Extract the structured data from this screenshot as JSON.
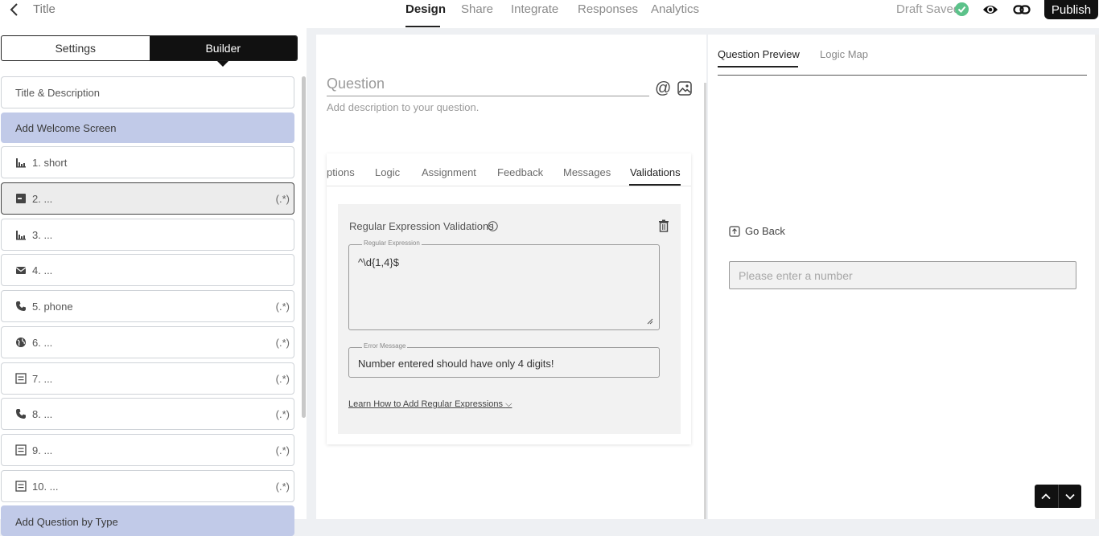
{
  "header": {
    "title": "Title",
    "tabs": [
      {
        "label": "Design",
        "active": true
      },
      {
        "label": "Share"
      },
      {
        "label": "Integrate"
      },
      {
        "label": "Responses"
      },
      {
        "label": "Analytics"
      }
    ],
    "draft_status": "Draft Saved",
    "publish_label": "Publish"
  },
  "sidebar": {
    "segments": {
      "settings": "Settings",
      "builder": "Builder"
    },
    "items": [
      {
        "label": "Title & Description",
        "icon": "none"
      },
      {
        "label": "Add Welcome Screen",
        "icon": "none"
      },
      {
        "label": "1. short",
        "icon": "bars-icon",
        "regex": ""
      },
      {
        "label": "2. ...",
        "icon": "number-icon",
        "regex": "(.*)"
      },
      {
        "label": "3. ...",
        "icon": "bars-icon",
        "regex": ""
      },
      {
        "label": "4. ...",
        "icon": "mail-icon",
        "regex": ""
      },
      {
        "label": "5. phone",
        "icon": "phone-icon",
        "regex": "(.*)"
      },
      {
        "label": "6. ...",
        "icon": "globe-icon",
        "regex": "(.*)"
      },
      {
        "label": "7. ...",
        "icon": "list-icon",
        "regex": "(.*)"
      },
      {
        "label": "8. ...",
        "icon": "phone-icon",
        "regex": "(.*)"
      },
      {
        "label": "9. ...",
        "icon": "list-icon",
        "regex": "(.*)"
      },
      {
        "label": "10. ...",
        "icon": "list-icon",
        "regex": "(.*)"
      },
      {
        "label": "Add Question by Type",
        "icon": "none"
      }
    ]
  },
  "editor": {
    "question_placeholder": "Question",
    "description_placeholder": "Add description to your question.",
    "subtabs": [
      "ptions",
      "Logic",
      "Assignment",
      "Feedback",
      "Messages",
      "Validations"
    ],
    "active_subtab": "Validations",
    "validation": {
      "title": "Regular Expression Validations",
      "regex_label": "Regular Expression",
      "regex_value": "^\\d{1,4}$",
      "error_label": "Error Message",
      "error_value": "Number entered should have only 4 digits!",
      "learn_link": "Learn How to Add Regular Expressions"
    }
  },
  "preview": {
    "tabs": [
      {
        "label": "Question Preview",
        "active": true
      },
      {
        "label": "Logic Map"
      }
    ],
    "go_back": "Go Back",
    "input_placeholder": "Please enter a number"
  },
  "colors": {
    "accent": "#111111",
    "highlight": "#c1cae8",
    "success": "#5cc28a"
  }
}
